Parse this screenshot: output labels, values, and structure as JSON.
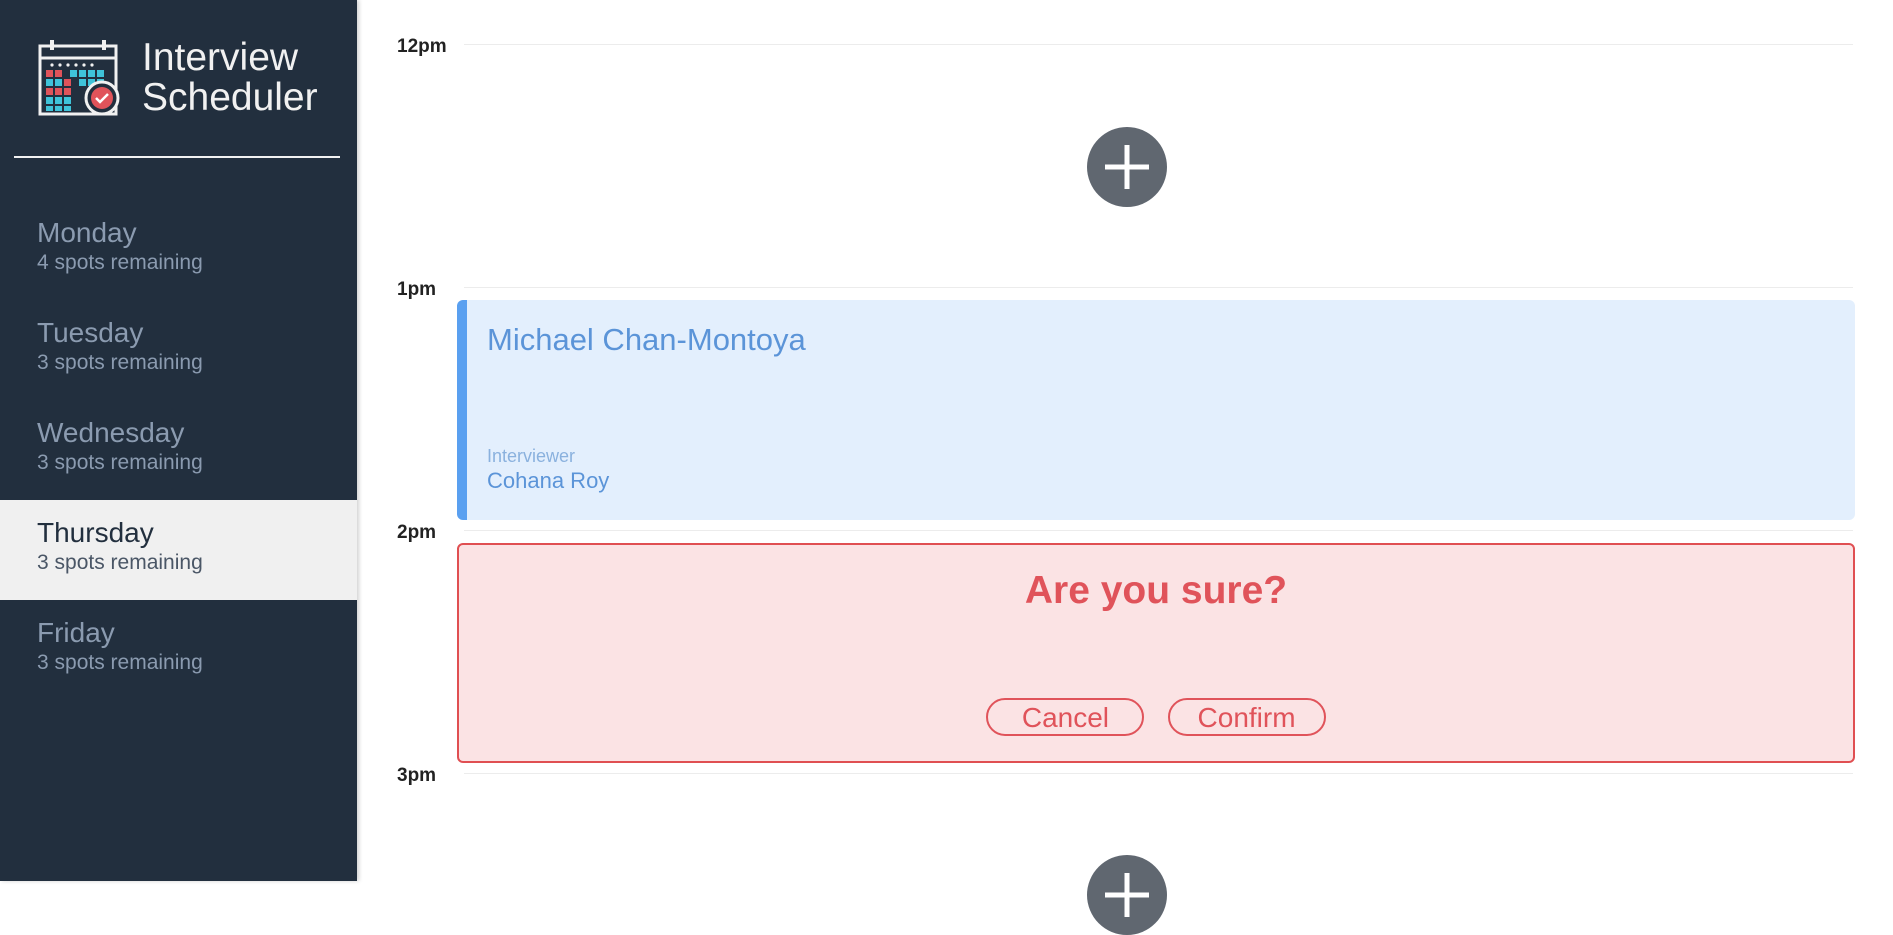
{
  "app": {
    "title_line1": "Interview",
    "title_line2": "Scheduler",
    "logo_icon": "calendar-check-icon"
  },
  "colors": {
    "sidebar_bg": "#222f3e",
    "selected_day_bg": "#f0f0f0",
    "appointment_bg": "#e3effd",
    "appointment_accent": "#5aa0f0",
    "confirm_bg": "#fbe3e4",
    "danger": "#e0535a",
    "add_button": "#606770"
  },
  "days": [
    {
      "name": "Monday",
      "spots": "4 spots remaining",
      "selected": false
    },
    {
      "name": "Tuesday",
      "spots": "3 spots remaining",
      "selected": false
    },
    {
      "name": "Wednesday",
      "spots": "3 spots remaining",
      "selected": false
    },
    {
      "name": "Thursday",
      "spots": "3 spots remaining",
      "selected": true
    },
    {
      "name": "Friday",
      "spots": "3 spots remaining",
      "selected": false
    }
  ],
  "schedule": {
    "times": [
      "12pm",
      "1pm",
      "2pm",
      "3pm"
    ],
    "add_icon": "plus-icon",
    "booked": {
      "student": "Michael Chan-Montoya",
      "interviewer_label": "Interviewer",
      "interviewer": "Cohana Roy"
    },
    "confirm": {
      "message": "Are you sure?",
      "cancel_label": "Cancel",
      "confirm_label": "Confirm"
    }
  }
}
